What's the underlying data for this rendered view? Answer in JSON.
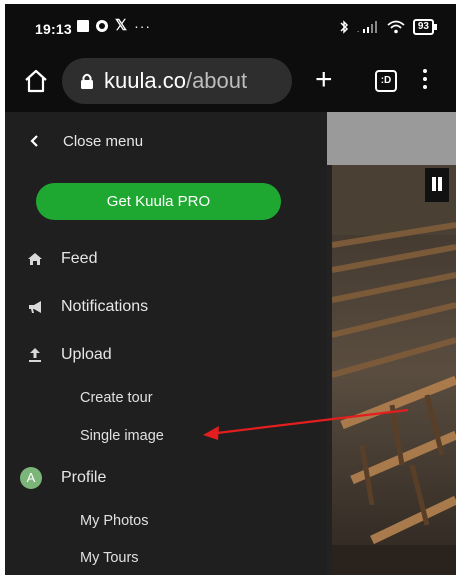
{
  "status_bar": {
    "time": "19:13",
    "battery": "93"
  },
  "browser": {
    "url_domain": "kuula.co",
    "url_path": "/about",
    "tabs_count": ":D"
  },
  "menu": {
    "close_label": "Close menu",
    "pro_button": "Get Kuula PRO",
    "items": [
      {
        "label": "Feed",
        "icon": "home-icon"
      },
      {
        "label": "Notifications",
        "icon": "megaphone-icon"
      },
      {
        "label": "Upload",
        "icon": "upload-icon"
      },
      {
        "label": "Profile",
        "icon": "avatar"
      }
    ],
    "upload_sub": [
      "Create tour",
      "Single image"
    ],
    "profile_sub": [
      "My Photos",
      "My Tours"
    ],
    "avatar_letter": "A"
  },
  "colors": {
    "accent_green": "#1fa831",
    "drawer_bg": "#1f1f1f",
    "annotation_red": "#e41e1e"
  }
}
